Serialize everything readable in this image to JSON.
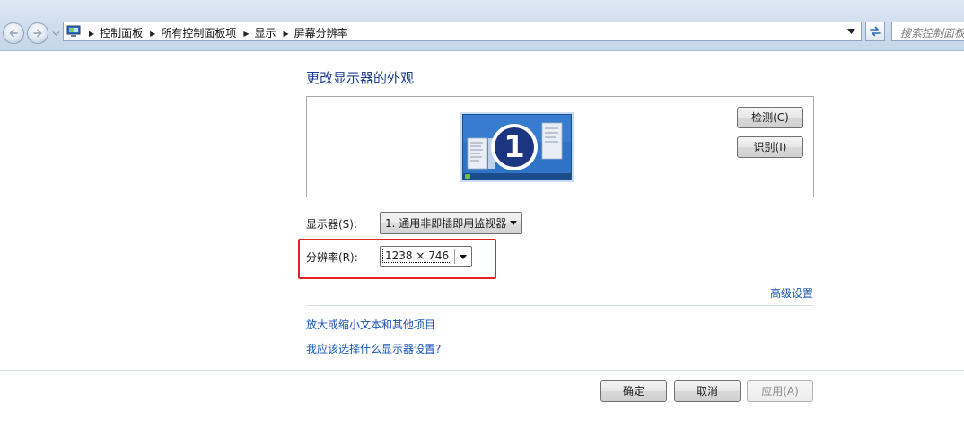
{
  "address_bar": {
    "breadcrumbs": [
      "控制面板",
      "所有控制面板项",
      "显示",
      "屏幕分辨率"
    ],
    "search_placeholder": "搜索控制面板"
  },
  "main": {
    "title": "更改显示器的外观",
    "preview": {
      "monitor_number": "1",
      "detect_label": "检测(C)",
      "identify_label": "识别(I)"
    },
    "display": {
      "label": "显示器(S):",
      "value": "1. 通用非即插即用监视器"
    },
    "resolution": {
      "label": "分辨率(R):",
      "value": "1238 × 746"
    },
    "advanced_link": "高级设置",
    "links": [
      "放大或缩小文本和其他项目",
      "我应该选择什么显示器设置?"
    ]
  },
  "footer": {
    "ok_label": "确定",
    "cancel_label": "取消",
    "apply_label": "应用(A)"
  },
  "colors": {
    "link": "#1a56b8",
    "title": "#1e3f8f",
    "highlight_box": "#e02424",
    "monitor_blue": "#2a6dc0"
  },
  "icons": [
    "back-arrow-icon",
    "forward-arrow-icon",
    "control-panel-icon",
    "chevron-right-icon",
    "chevron-down-icon",
    "refresh-icon",
    "monitor-icon"
  ]
}
